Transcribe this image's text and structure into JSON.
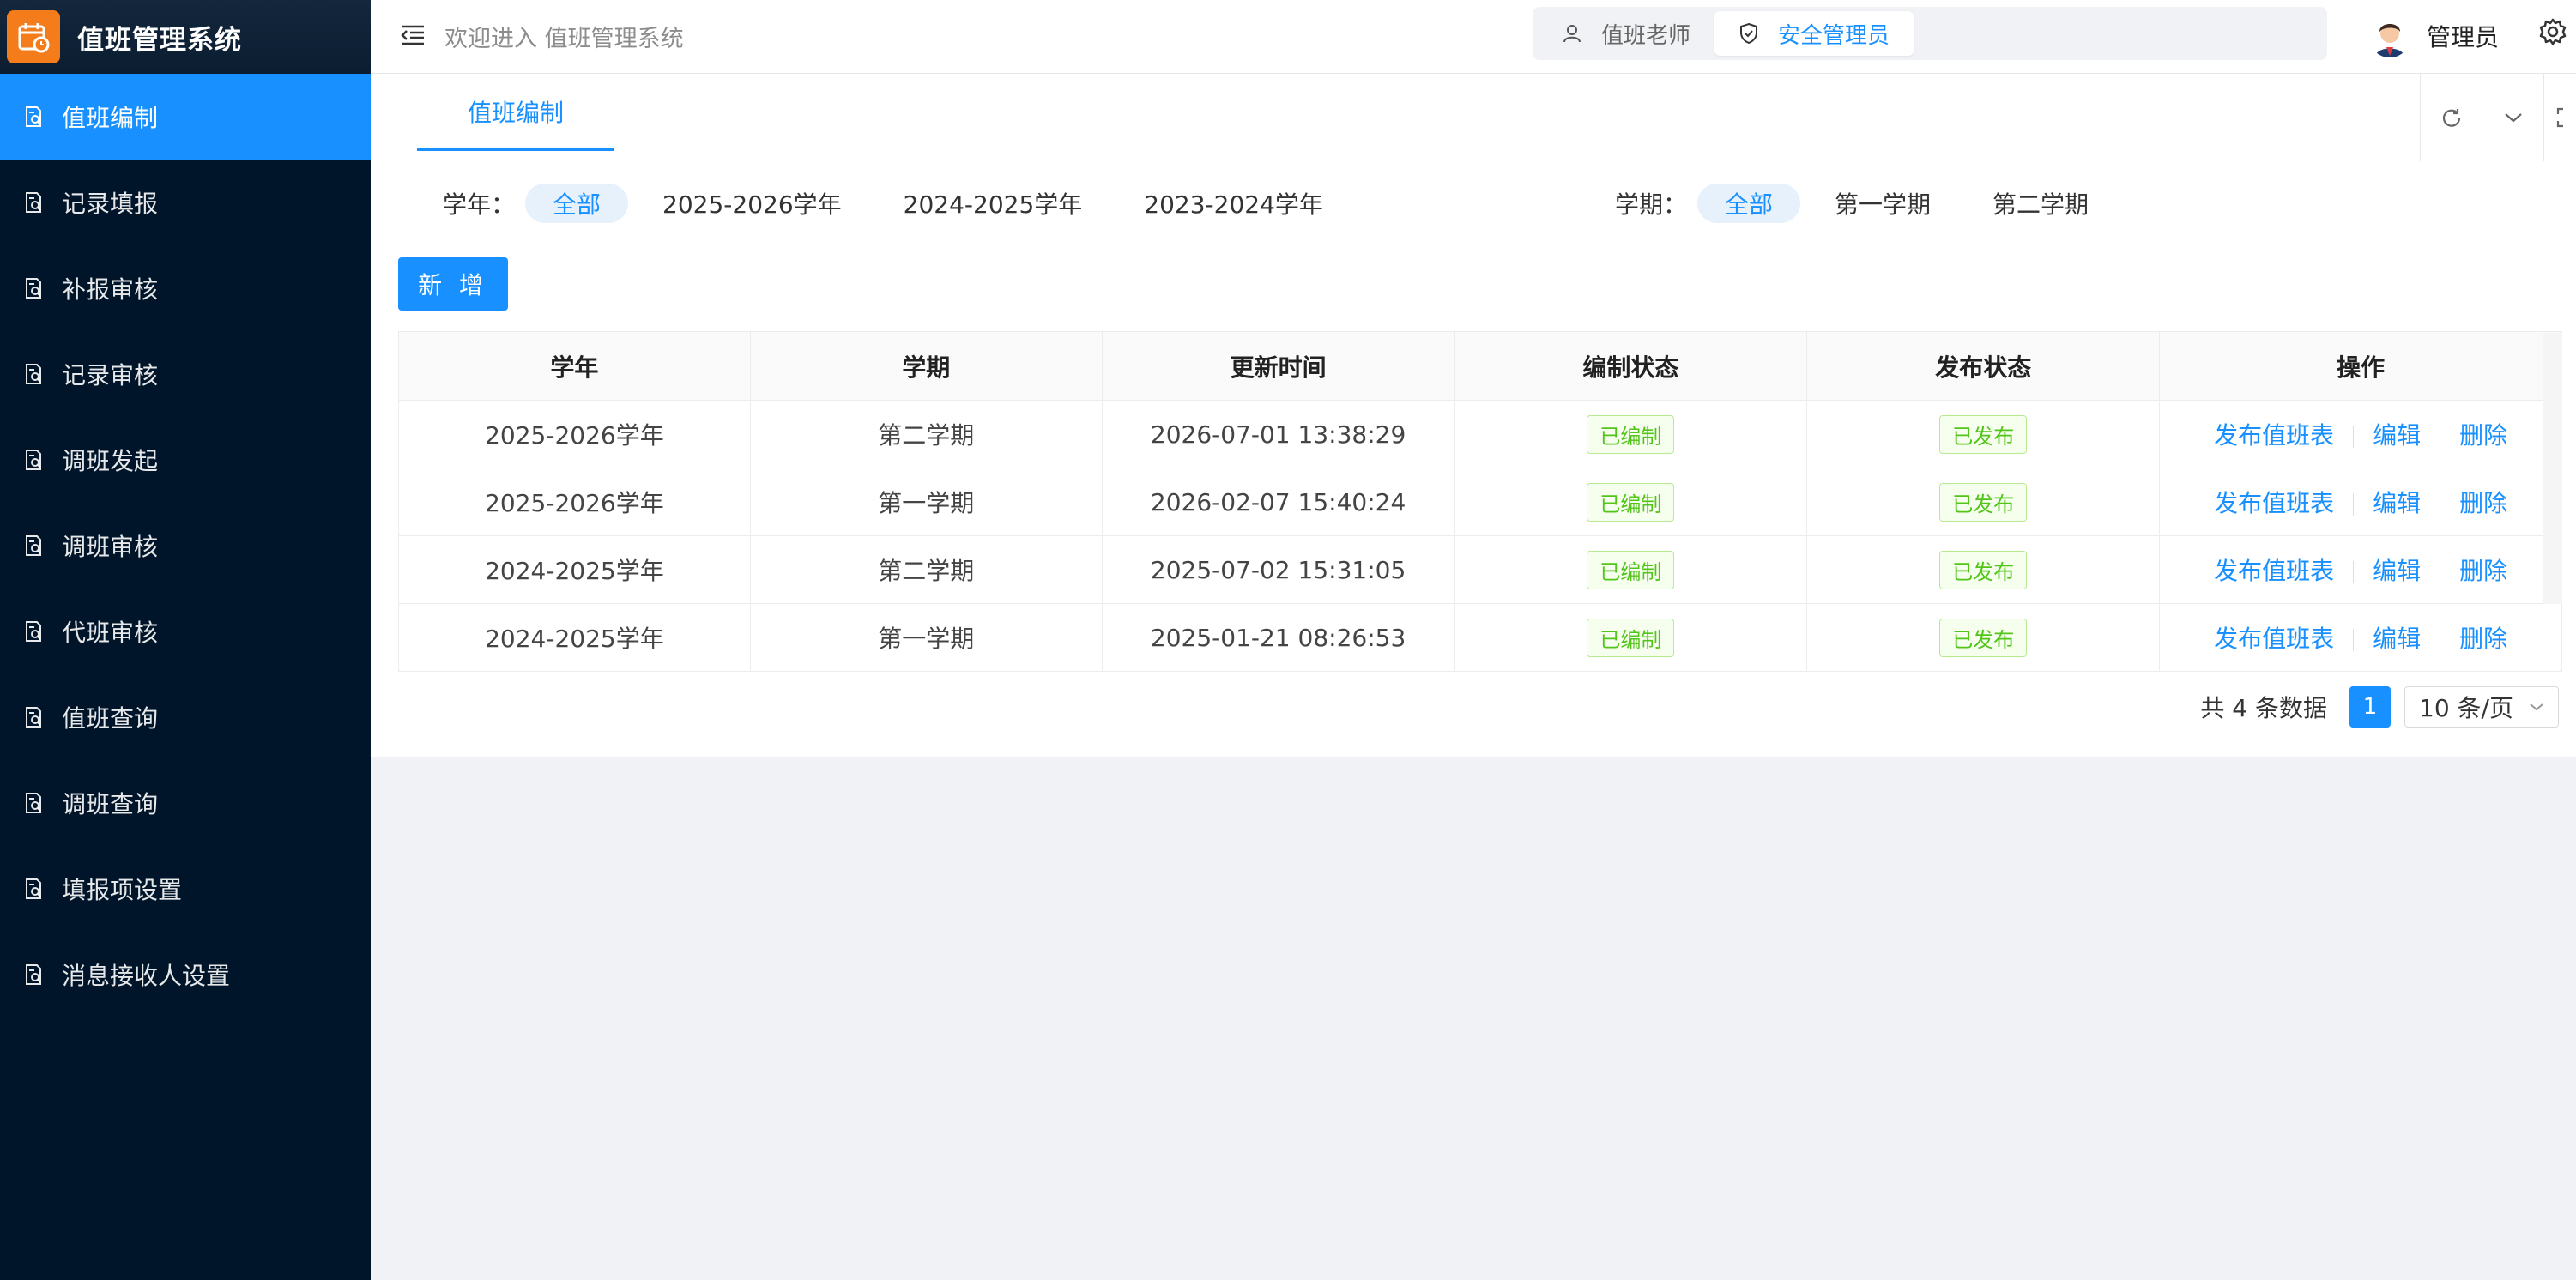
{
  "app": {
    "title": "值班管理系统",
    "welcome": "欢迎进入 值班管理系统"
  },
  "sidebar": {
    "items": [
      {
        "label": "值班编制",
        "active": true
      },
      {
        "label": "记录填报"
      },
      {
        "label": "补报审核"
      },
      {
        "label": "记录审核"
      },
      {
        "label": "调班发起"
      },
      {
        "label": "调班审核"
      },
      {
        "label": "代班审核"
      },
      {
        "label": "值班查询"
      },
      {
        "label": "调班查询"
      },
      {
        "label": "填报项设置"
      },
      {
        "label": "消息接收人设置"
      }
    ]
  },
  "header": {
    "roles": [
      {
        "label": "值班老师",
        "active": false
      },
      {
        "label": "安全管理员",
        "active": true
      }
    ],
    "user_name": "管理员"
  },
  "tabs": [
    {
      "label": "值班编制",
      "active": true
    }
  ],
  "filters": {
    "year_label": "学年：",
    "years": [
      "全部",
      "2025-2026学年",
      "2024-2025学年",
      "2023-2024学年"
    ],
    "term_label": "学期：",
    "terms": [
      "全部",
      "第一学期",
      "第二学期"
    ]
  },
  "add_button": "新 增",
  "table": {
    "headers": [
      "学年",
      "学期",
      "更新时间",
      "编制状态",
      "发布状态",
      "操作"
    ],
    "rows": [
      {
        "year": "2025-2026学年",
        "term": "第二学期",
        "updated": "2026-07-01 13:38:29",
        "compile": "已编制",
        "publish": "已发布"
      },
      {
        "year": "2025-2026学年",
        "term": "第一学期",
        "updated": "2026-02-07 15:40:24",
        "compile": "已编制",
        "publish": "已发布"
      },
      {
        "year": "2024-2025学年",
        "term": "第二学期",
        "updated": "2025-07-02 15:31:05",
        "compile": "已编制",
        "publish": "已发布"
      },
      {
        "year": "2024-2025学年",
        "term": "第一学期",
        "updated": "2025-01-21 08:26:53",
        "compile": "已编制",
        "publish": "已发布"
      }
    ],
    "actions": [
      "发布值班表",
      "编辑",
      "删除"
    ]
  },
  "pagination": {
    "total": "共 4 条数据",
    "current": "1",
    "page_size": "10 条/页"
  },
  "colors": {
    "primary": "#1890ff",
    "sidebar_bg": "#001529",
    "logo_bg": "#f47c1b",
    "success": "#52c41a"
  }
}
